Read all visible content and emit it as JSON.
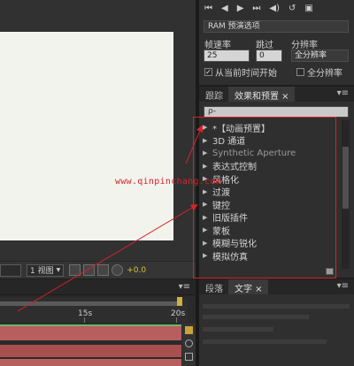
{
  "composition": {
    "view_count": "1 视图",
    "view_count_arrow": "▼",
    "exposure": "+0.0"
  },
  "preview": {
    "controls": [
      "⏮",
      "◀",
      "▶",
      "⏭",
      "◀)",
      "↺",
      "▣"
    ],
    "ram_label": "RAM 预演选项",
    "frame_rate_label": "帧速率",
    "skip_label": "跳过",
    "resolution_label": "分辨率",
    "frame_rate_value": "25",
    "skip_value": "0",
    "resolution_value": "全分辨率",
    "from_current_label": "从当前时间开始",
    "full_screen_label": "全分辨率"
  },
  "effects_panel": {
    "tabs": [
      {
        "label": "跟踪"
      },
      {
        "label": "效果和预置 ×"
      }
    ],
    "search_placeholder": "ρ-",
    "items": [
      {
        "label": "*【动画预置】"
      },
      {
        "label": "3D 通道"
      },
      {
        "label": "Synthetic Aperture"
      },
      {
        "label": "表达式控制"
      },
      {
        "label": "风格化"
      },
      {
        "label": "过渡"
      },
      {
        "label": "键控"
      },
      {
        "label": "旧版插件"
      },
      {
        "label": "蒙板"
      },
      {
        "label": "模糊与锐化"
      },
      {
        "label": "模拟仿真"
      }
    ]
  },
  "timeline": {
    "ruler_labels": [
      "15s",
      "20s"
    ]
  },
  "text_panel": {
    "tabs": [
      {
        "label": "段落"
      },
      {
        "label": "文字 ×"
      }
    ]
  },
  "watermark": "www.qinpinchang.com",
  "colors": {
    "annotation_red": "#d8222a",
    "exposure_yellow": "#d6c23a"
  }
}
